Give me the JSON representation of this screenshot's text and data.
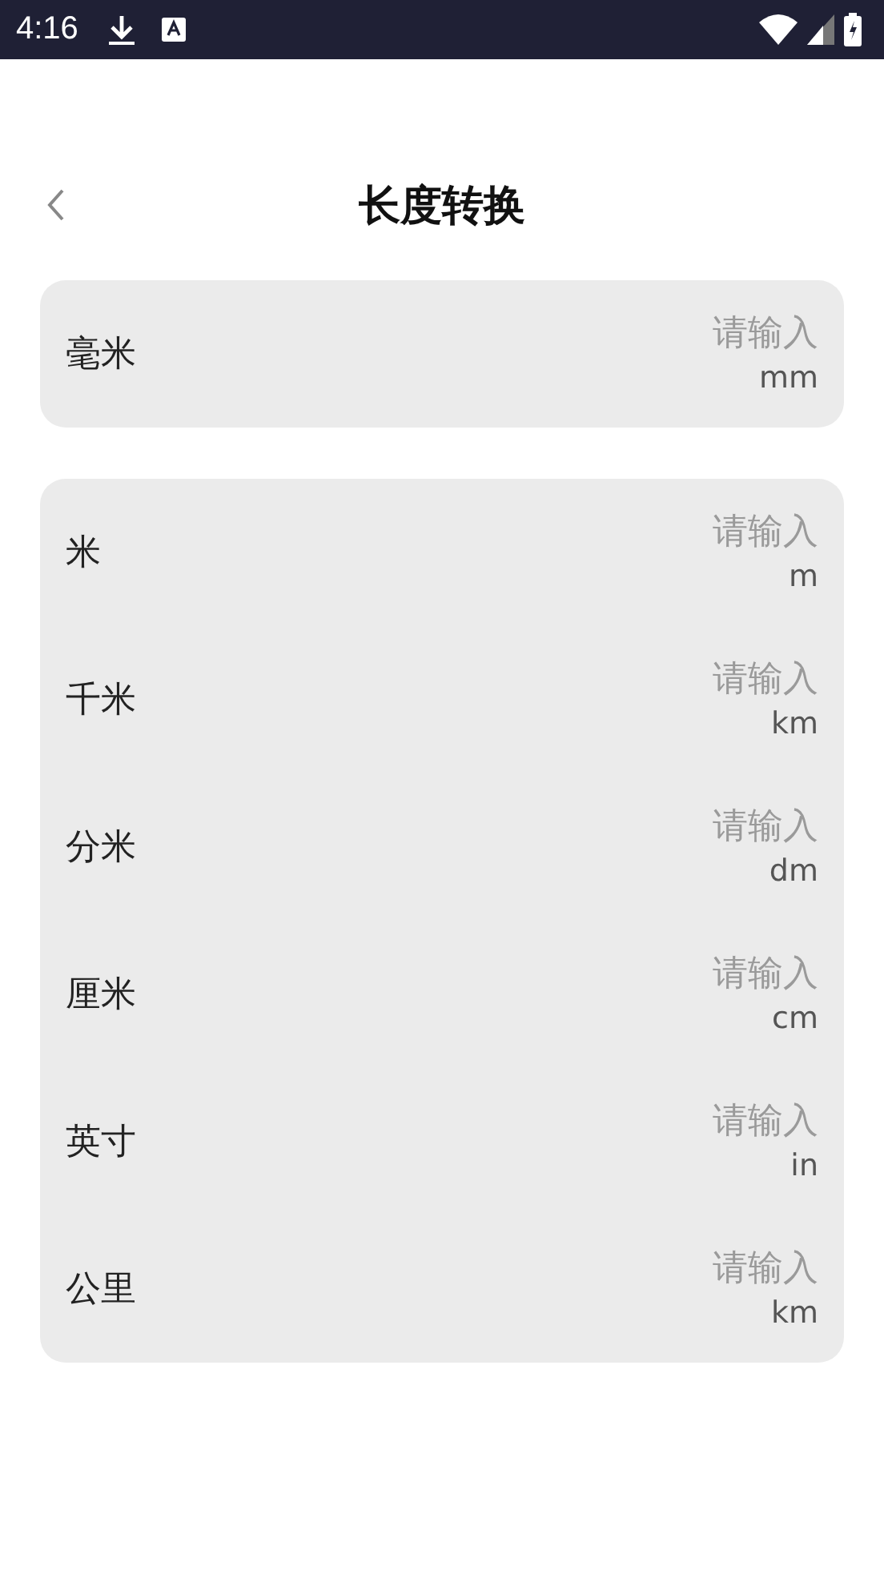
{
  "status_bar": {
    "time": "4:16"
  },
  "header": {
    "title": "长度转换"
  },
  "groups": [
    {
      "rows": [
        {
          "label": "毫米",
          "placeholder": "请输入",
          "unit": "mm"
        }
      ]
    },
    {
      "rows": [
        {
          "label": "米",
          "placeholder": "请输入",
          "unit": "m"
        },
        {
          "label": "千米",
          "placeholder": "请输入",
          "unit": "km"
        },
        {
          "label": "分米",
          "placeholder": "请输入",
          "unit": "dm"
        },
        {
          "label": "厘米",
          "placeholder": "请输入",
          "unit": "cm"
        },
        {
          "label": "英寸",
          "placeholder": "请输入",
          "unit": "in"
        },
        {
          "label": "公里",
          "placeholder": "请输入",
          "unit": "km"
        }
      ]
    }
  ]
}
